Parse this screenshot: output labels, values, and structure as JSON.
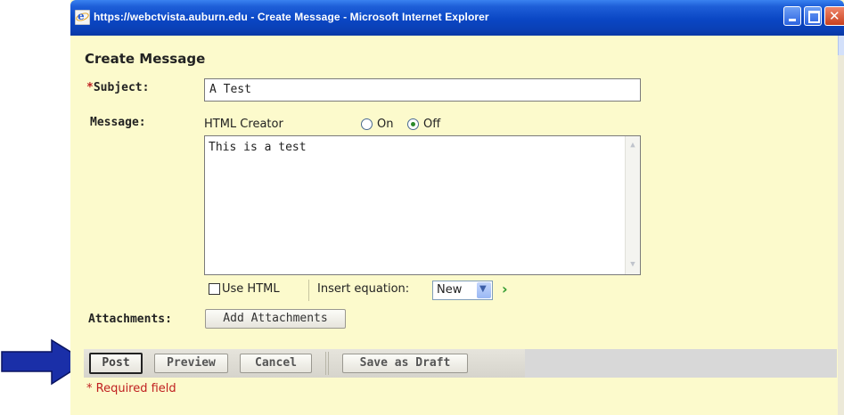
{
  "window": {
    "title": "https://webctvista.auburn.edu - Create Message - Microsoft Internet Explorer"
  },
  "form": {
    "heading": "Create Message",
    "subject": {
      "required_mark": "*",
      "label": "Subject:",
      "value": "A Test"
    },
    "message": {
      "label": "Message:",
      "html_creator_label": "HTML Creator",
      "options": [
        "On",
        "Off"
      ],
      "selected": "Off",
      "body": "This is a test"
    },
    "use_html_label": "Use HTML",
    "use_html_checked": false,
    "insert_equation_label": "Insert equation:",
    "insert_equation_value": "New",
    "attachments": {
      "label": "Attachments:",
      "button": "Add Attachments"
    }
  },
  "actions": {
    "post": "Post",
    "preview": "Preview",
    "cancel": "Cancel",
    "save_draft": "Save as Draft"
  },
  "required_note": "* Required field",
  "annotation": {
    "arrow_color": "#1a2fa8"
  }
}
